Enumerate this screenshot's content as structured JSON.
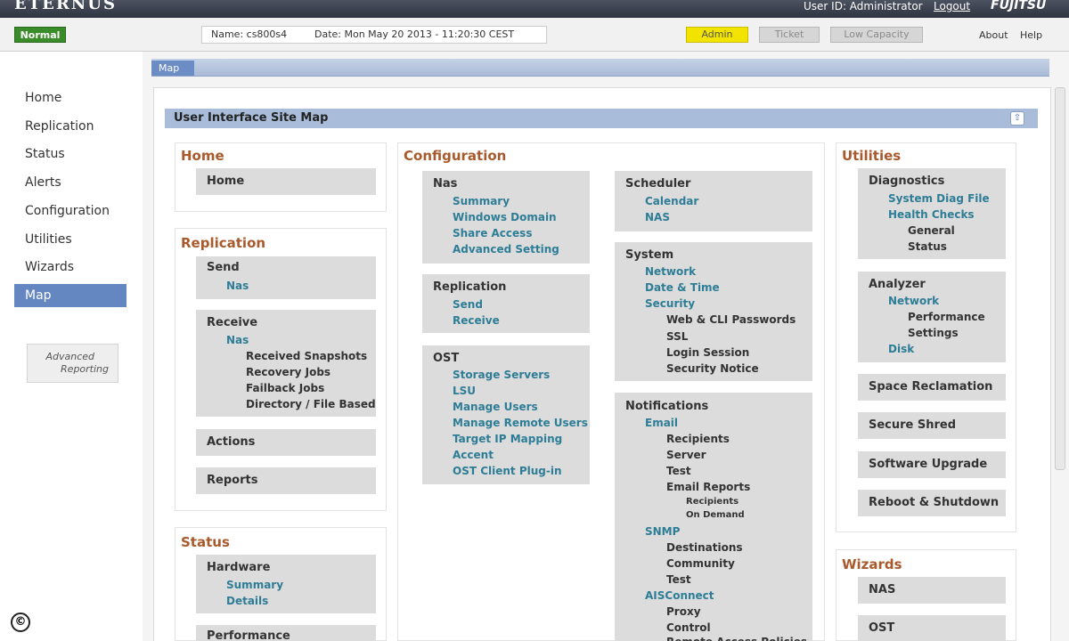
{
  "topbar": {
    "brand": "ETERNUS",
    "user_id": "User ID: Administrator",
    "logout": "Logout",
    "vendor": "FUJITSU"
  },
  "status": {
    "badge": "Normal",
    "name": "Name: cs800s4",
    "date": "Date: Mon May 20 2013 - 11:20:30 CEST",
    "admin": "Admin",
    "ticket": "Ticket",
    "low_capacity": "Low Capacity",
    "about": "About",
    "help": "Help"
  },
  "sidebar": {
    "items": [
      {
        "label": "Home"
      },
      {
        "label": "Replication"
      },
      {
        "label": "Status"
      },
      {
        "label": "Alerts"
      },
      {
        "label": "Configuration"
      },
      {
        "label": "Utilities"
      },
      {
        "label": "Wizards"
      },
      {
        "label": "Map"
      }
    ],
    "advanced_line1": "Advanced",
    "advanced_line2": "Reporting",
    "copyright": "©"
  },
  "tab": {
    "label": "Map"
  },
  "sitemap": {
    "title": "User Interface Site Map",
    "home": {
      "title": "Home",
      "box": "Home"
    },
    "replication": {
      "title": "Replication",
      "send": "Send",
      "send_nas": "Nas",
      "receive": "Receive",
      "receive_nas": "Nas",
      "receive_items": [
        "Received Snapshots",
        "Recovery Jobs",
        "Failback Jobs",
        "Directory / File Based"
      ],
      "actions": "Actions",
      "reports": "Reports"
    },
    "status": {
      "title": "Status",
      "hardware": "Hardware",
      "summary": "Summary",
      "details": "Details",
      "performance": "Performance"
    },
    "configuration": {
      "title": "Configuration",
      "nas": "Nas",
      "nas_links": [
        "Summary",
        "Windows Domain",
        "Share Access",
        "Advanced Setting"
      ],
      "replication": "Replication",
      "replication_links": [
        "Send",
        "Receive"
      ],
      "ost": "OST",
      "ost_links": [
        "Storage Servers",
        "LSU",
        "Manage Users",
        "Manage Remote Users",
        "Target IP Mapping",
        "Accent",
        "OST Client Plug-in"
      ],
      "scheduler": "Scheduler",
      "scheduler_links": [
        "Calendar",
        "NAS"
      ],
      "system": "System",
      "system_links": [
        "Network",
        "Date & Time",
        "Security"
      ],
      "security_items": [
        "Web & CLI Passwords",
        "SSL",
        "Login Session",
        "Security Notice"
      ],
      "notifications": "Notifications",
      "email": "Email",
      "email_items": [
        "Recipients",
        "Server",
        "Test",
        "Email Reports"
      ],
      "email_reports_items": [
        "Recipients",
        "On Demand"
      ],
      "snmp": "SNMP",
      "snmp_items": [
        "Destinations",
        "Community",
        "Test"
      ],
      "aisconnect": "AISConnect",
      "aisconnect_items": [
        "Proxy",
        "Control",
        "Remote Access Policies"
      ]
    },
    "utilities": {
      "title": "Utilities",
      "diagnostics": "Diagnostics",
      "system_diag": "System Diag File",
      "health_checks": "Health Checks",
      "health_items": [
        "General",
        "Status"
      ],
      "analyzer": "Analyzer",
      "network": "Network",
      "network_items": [
        "Performance",
        "Settings"
      ],
      "disk": "Disk",
      "space_reclamation": "Space Reclamation",
      "secure_shred": "Secure Shred",
      "software_upgrade": "Software Upgrade",
      "reboot_shutdown": "Reboot & Shutdown"
    },
    "wizards": {
      "title": "Wizards",
      "nas": "NAS",
      "ost": "OST"
    }
  },
  "colors": {
    "section_title": "#a85a2c",
    "link": "#2e7d96",
    "nav_active": "#6487c2",
    "badge_normal": "#3a8c2a",
    "admin": "#f3e400"
  }
}
